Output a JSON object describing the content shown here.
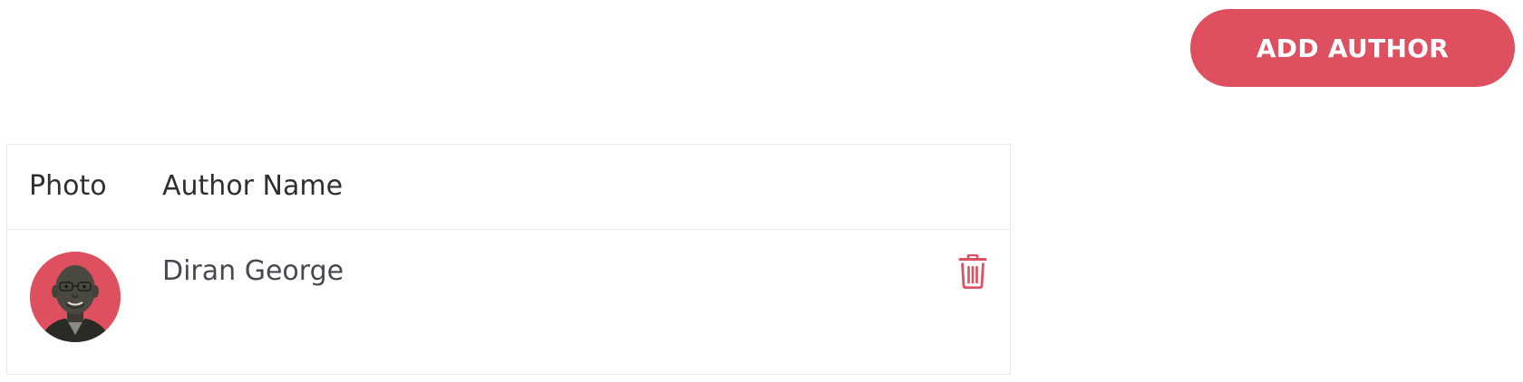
{
  "toolbar": {
    "add_author_label": "ADD AUTHOR"
  },
  "table": {
    "columns": [
      "Photo",
      "Author Name"
    ],
    "rows": [
      {
        "author_name": "Diran George",
        "photo_icon": "author-photo",
        "delete_icon": "trash-icon"
      }
    ]
  },
  "colors": {
    "accent": "#de4f5f",
    "border": "#e8e8e8",
    "text": "#333333"
  }
}
